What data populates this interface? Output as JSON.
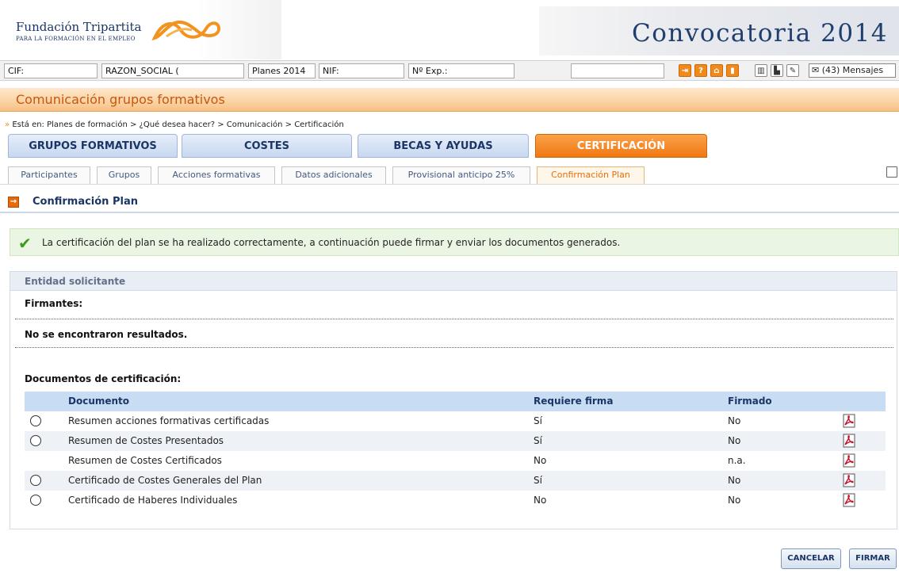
{
  "header": {
    "logo_title": "Fundación Tripartita",
    "logo_subtitle": "PARA LA FORMACIÓN EN EL EMPLEO",
    "banner_title": "Convocatoria 2014"
  },
  "infobar": {
    "cif_label": "CIF:",
    "razon_social": "RAZON_SOCIAL (",
    "planes": "Planes 2014",
    "nif_label": "NIF:",
    "exp_label": "Nº Exp.:",
    "search_value": "",
    "icons": [
      "exit-icon",
      "help-icon",
      "home-icon",
      "documents-icon",
      "building-icon",
      "chart-icon",
      "edit-icon"
    ],
    "messages_label": "(43) Mensajes"
  },
  "section_title": "Comunicación grupos formativos",
  "breadcrumb": {
    "prefix": "»",
    "text": "Está en:  Planes de formación > ¿Qué desea hacer? > Comunicación > Certificación"
  },
  "main_tabs": [
    {
      "label": "GRUPOS FORMATIVOS",
      "active": false
    },
    {
      "label": "COSTES",
      "active": false
    },
    {
      "label": "BECAS Y AYUDAS",
      "active": false
    },
    {
      "label": "CERTIFICACIÓN",
      "active": true
    }
  ],
  "sub_tabs": [
    {
      "label": "Participantes",
      "active": false
    },
    {
      "label": "Grupos",
      "active": false
    },
    {
      "label": "Acciones formativas",
      "active": false
    },
    {
      "label": "Datos adicionales",
      "active": false
    },
    {
      "label": "Provisional anticipo 25%",
      "active": false
    },
    {
      "label": "Confirmación Plan",
      "active": true
    }
  ],
  "page_title": "Confirmación Plan",
  "success_message": "La certificación del plan se ha realizado correctamente, a continuación puede firmar y enviar los documentos generados.",
  "panel": {
    "title": "Entidad solicitante",
    "firmantes_label": "Firmantes:",
    "no_results": "No se encontraron resultados.",
    "documents_label": "Documentos de certificación:",
    "table": {
      "headers": [
        "Documento",
        "Requiere firma",
        "Firmado"
      ],
      "rows": [
        {
          "documento": "Resumen acciones formativas certificadas",
          "requiere_firma": "Sí",
          "firmado": "No",
          "selectable": true
        },
        {
          "documento": "Resumen de Costes Presentados",
          "requiere_firma": "Sí",
          "firmado": "No",
          "selectable": true
        },
        {
          "documento": "Resumen de Costes Certificados",
          "requiere_firma": "No",
          "firmado": "n.a.",
          "selectable": false
        },
        {
          "documento": "Certificado de Costes Generales del Plan",
          "requiere_firma": "Sí",
          "firmado": "No",
          "selectable": true
        },
        {
          "documento": "Certificado de Haberes Individuales",
          "requiere_firma": "No",
          "firmado": "No",
          "selectable": true
        }
      ]
    }
  },
  "buttons": {
    "cancel": "CANCELAR",
    "sign": "FIRMAR"
  },
  "colors": {
    "accent_orange": "#f07812",
    "brand_blue": "#1b3566",
    "success_green": "#3d9a1b"
  }
}
